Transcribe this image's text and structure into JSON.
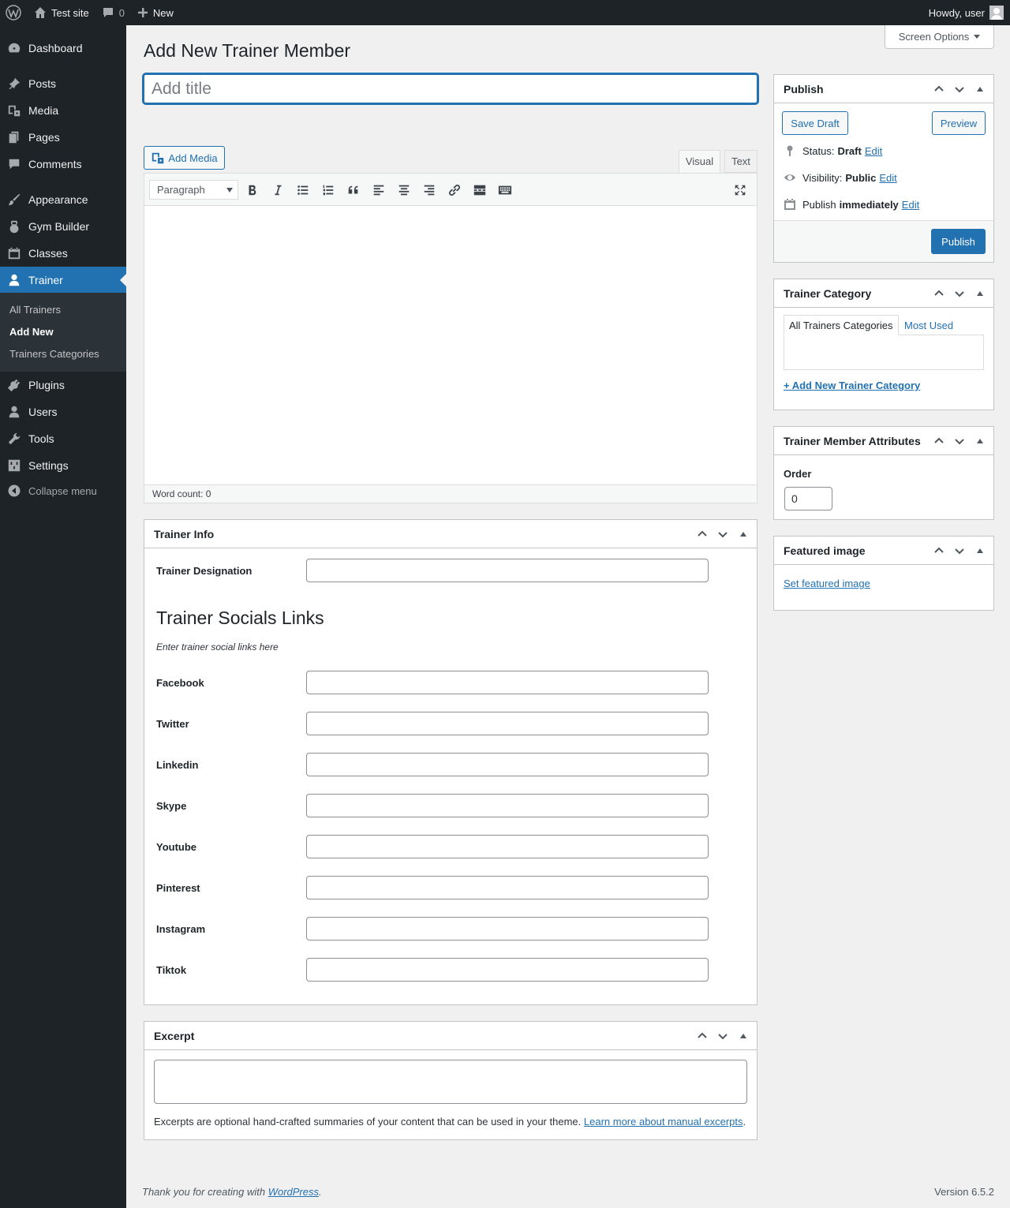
{
  "admin_bar": {
    "site_name": "Test site",
    "comments_count": "0",
    "new_label": "New",
    "howdy": "Howdy, user"
  },
  "sidebar": {
    "items": [
      {
        "label": "Dashboard",
        "icon": "dashboard-icon"
      },
      {
        "label": "Posts",
        "icon": "pin-icon"
      },
      {
        "label": "Media",
        "icon": "media-icon"
      },
      {
        "label": "Pages",
        "icon": "pages-icon"
      },
      {
        "label": "Comments",
        "icon": "comment-icon"
      },
      {
        "label": "Appearance",
        "icon": "brush-icon"
      },
      {
        "label": "Gym Builder",
        "icon": "kettlebell-icon"
      },
      {
        "label": "Classes",
        "icon": "calendar-icon"
      },
      {
        "label": "Trainer",
        "icon": "trainer-icon"
      },
      {
        "label": "Plugins",
        "icon": "plugin-icon"
      },
      {
        "label": "Users",
        "icon": "user-icon"
      },
      {
        "label": "Tools",
        "icon": "wrench-icon"
      },
      {
        "label": "Settings",
        "icon": "settings-icon"
      }
    ],
    "submenu": [
      "All Trainers",
      "Add New",
      "Trainers Categories"
    ],
    "collapse_label": "Collapse menu"
  },
  "screen_options": "Screen Options",
  "page_title": "Add New Trainer Member",
  "title_placeholder": "Add title",
  "editor": {
    "add_media": "Add Media",
    "tab_visual": "Visual",
    "tab_text": "Text",
    "format": "Paragraph",
    "word_count": "Word count: 0"
  },
  "trainer_info": {
    "heading": "Trainer Info",
    "designation_label": "Trainer Designation",
    "socials_heading": "Trainer Socials Links",
    "socials_desc": "Enter trainer social links here",
    "socials": [
      "Facebook",
      "Twitter",
      "Linkedin",
      "Skype",
      "Youtube",
      "Pinterest",
      "Instagram",
      "Tiktok"
    ]
  },
  "excerpt": {
    "heading": "Excerpt",
    "help_text": "Excerpts are optional hand-crafted summaries of your content that can be used in your theme.",
    "learn_more": "Learn more about manual excerpts"
  },
  "publish": {
    "heading": "Publish",
    "save_draft": "Save Draft",
    "preview": "Preview",
    "status_label": "Status:",
    "status_value": "Draft",
    "visibility_label": "Visibility:",
    "visibility_value": "Public",
    "publish_label": "Publish",
    "publish_value": "immediately",
    "edit": "Edit",
    "publish_button": "Publish"
  },
  "trainer_category": {
    "heading": "Trainer Category",
    "tab_all": "All Trainers Categories",
    "tab_most_used": "Most Used",
    "add_new": "+ Add New Trainer Category"
  },
  "attributes": {
    "heading": "Trainer Member Attributes",
    "order_label": "Order",
    "order_value": "0"
  },
  "featured_image": {
    "heading": "Featured image",
    "link": "Set featured image"
  },
  "footer": {
    "thanks_prefix": "Thank you for creating with",
    "wordpress": "WordPress",
    "version": "Version 6.5.2"
  },
  "colors": {
    "accent": "#2271b1",
    "sidebar_bg": "#1d2327",
    "page_bg": "#f0f0f1"
  }
}
